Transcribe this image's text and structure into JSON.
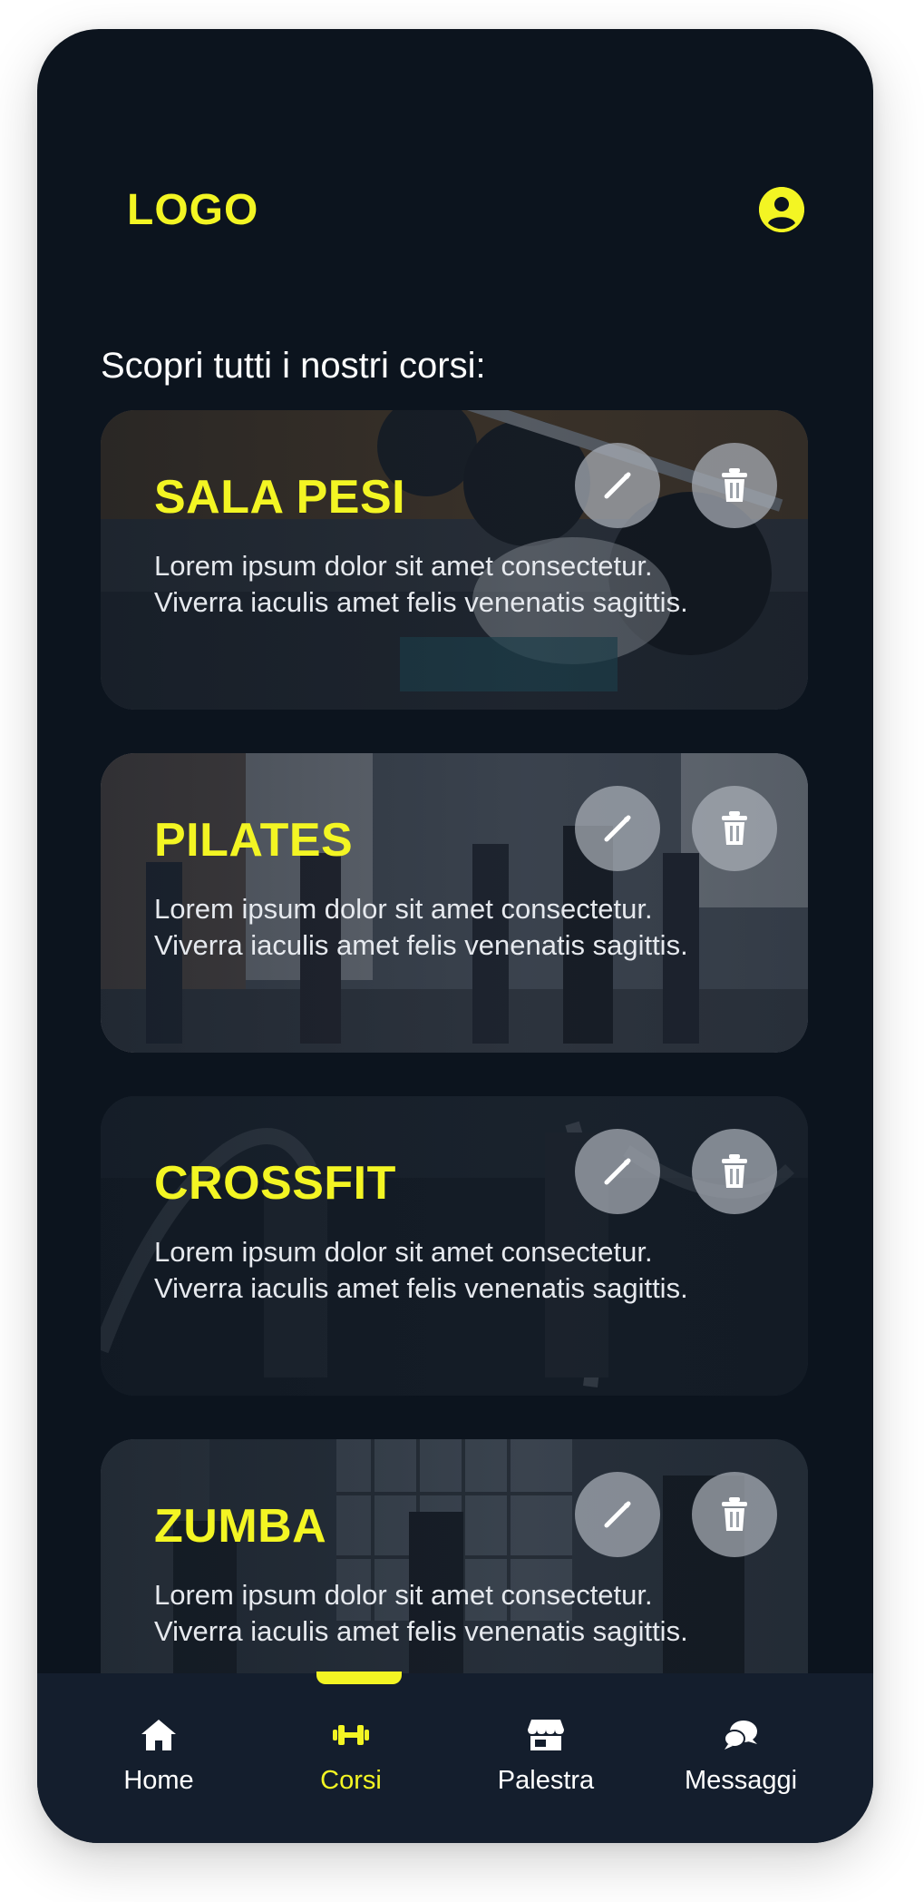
{
  "header": {
    "logo": "LOGO",
    "profile_icon": "user-circle-icon"
  },
  "intro": "Scopri tutti i nostri corsi:",
  "courses": [
    {
      "title": "SALA PESI",
      "description": "Lorem ipsum dolor sit amet consectetur. Viverra iaculis amet felis venenatis sagittis.",
      "edit_icon": "pencil-icon",
      "delete_icon": "trash-icon"
    },
    {
      "title": "PILATES",
      "description": "Lorem ipsum dolor sit amet consectetur. Viverra iaculis amet felis venenatis sagittis.",
      "edit_icon": "pencil-icon",
      "delete_icon": "trash-icon"
    },
    {
      "title": "CROSSFIT",
      "description": "Lorem ipsum dolor sit amet consectetur. Viverra iaculis amet felis venenatis sagittis.",
      "edit_icon": "pencil-icon",
      "delete_icon": "trash-icon"
    },
    {
      "title": "ZUMBA",
      "description": "Lorem ipsum dolor sit amet consectetur. Viverra iaculis amet felis venenatis sagittis.",
      "edit_icon": "pencil-icon",
      "delete_icon": "trash-icon"
    }
  ],
  "tabbar": {
    "active": "Corsi",
    "tabs": [
      {
        "label": "Home",
        "icon": "home-icon"
      },
      {
        "label": "Corsi",
        "icon": "dumbbell-icon"
      },
      {
        "label": "Palestra",
        "icon": "store-icon"
      },
      {
        "label": "Messaggi",
        "icon": "chat-bubbles-icon"
      }
    ]
  },
  "colors": {
    "accent": "#f3f523",
    "background": "#0c141e",
    "tabbar": "#141e2d",
    "card_button": "#aab0b8"
  }
}
